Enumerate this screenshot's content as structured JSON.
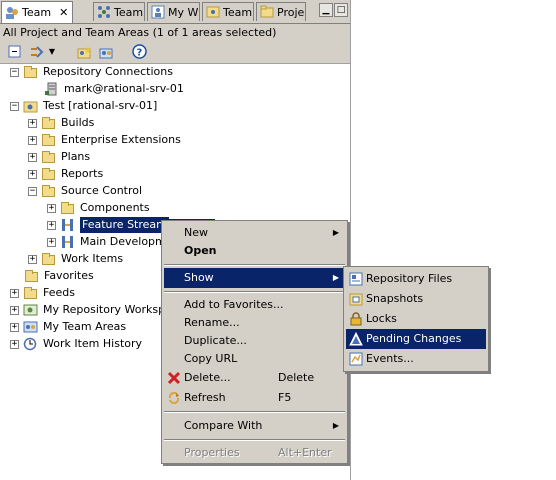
{
  "tabs": [
    {
      "label": "Team",
      "icon": "team-icon",
      "active": true
    },
    {
      "label": "Team",
      "icon": "team-org-icon"
    },
    {
      "label": "My W",
      "icon": "my-work-icon"
    },
    {
      "label": "Team",
      "icon": "team-artifacts-icon"
    },
    {
      "label": "Proje",
      "icon": "project-explorer-icon"
    }
  ],
  "filter_text": "All Project and Team Areas (1 of 1 areas selected)",
  "tree": {
    "repo_connections": "Repository Connections",
    "repo_user": "mark@rational-srv-01",
    "test": "Test [rational-srv-01]",
    "builds": "Builds",
    "enterprise": "Enterprise Extensions",
    "plans": "Plans",
    "reports": "Reports",
    "source_control": "Source Control",
    "components": "Components",
    "feature_stream": "Feature Stream",
    "main_dev": "Main Developme",
    "work_items": "Work Items",
    "favorites": "Favorites",
    "feeds": "Feeds",
    "my_workspaces": "My Repository Workspa",
    "my_team_areas": "My Team Areas",
    "wi_history": "Work Item History"
  },
  "context_menu": {
    "new": "New",
    "open": "Open",
    "show": "Show",
    "add_fav": "Add to Favorites...",
    "rename": "Rename...",
    "duplicate": "Duplicate...",
    "copy_url": "Copy URL",
    "delete": "Delete...",
    "delete_key": "Delete",
    "refresh": "Refresh",
    "refresh_key": "F5",
    "compare": "Compare With",
    "properties": "Properties",
    "properties_key": "Alt+Enter"
  },
  "show_submenu": {
    "repo_files": "Repository Files",
    "snapshots": "Snapshots",
    "locks": "Locks",
    "pending": "Pending Changes",
    "events": "Events..."
  },
  "colors": {
    "selection": "#0a246a",
    "chrome": "#d4d0c8",
    "folder": "#f2dc8c"
  }
}
